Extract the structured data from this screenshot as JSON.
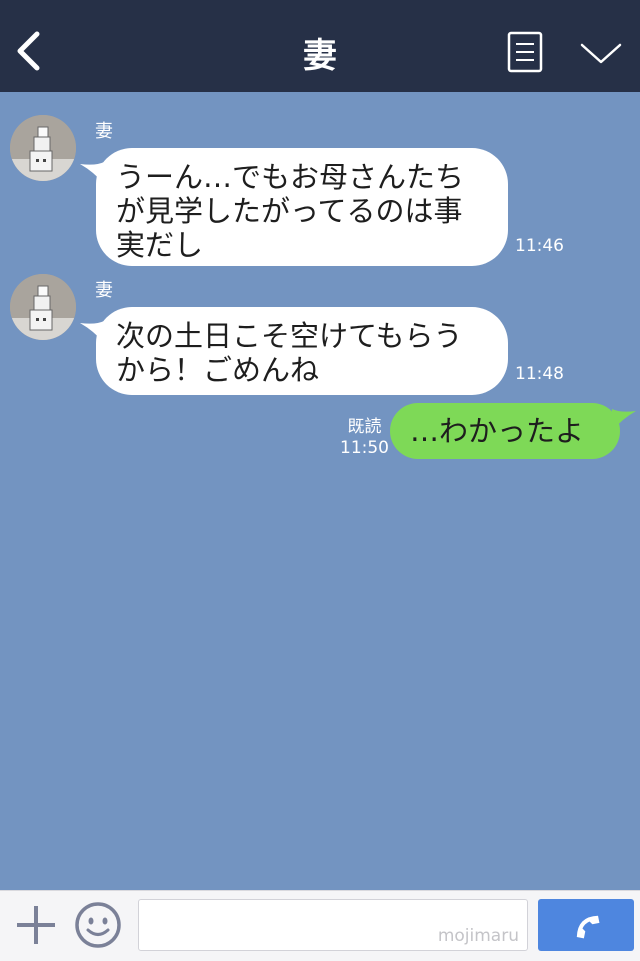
{
  "header": {
    "title": "妻",
    "icons": [
      "chevron-left-icon",
      "menu-list-icon",
      "chevron-down-icon"
    ]
  },
  "messages": [
    {
      "sender": "妻",
      "text_lines": [
        "うーん…でもお母さんたち",
        "が見学したがってるのは事",
        "実だし"
      ],
      "time": "11:46"
    },
    {
      "sender": "妻",
      "text_lines": [
        "次の土日こそ空けてもらう",
        "から！ごめんね"
      ],
      "time": "11:48"
    }
  ],
  "outgoing": {
    "text": "…わかったよ",
    "read_label": "既読",
    "time": "11:50"
  },
  "footer": {
    "watermark": "mojimaru",
    "icons": [
      "plus-icon",
      "emoji-icon",
      "phone-icon"
    ]
  },
  "colors": {
    "header_bg": "#263047",
    "chat_bg": "#7394c1",
    "incoming_bubble": "#ffffff",
    "outgoing_bubble": "#7ed957",
    "call_button": "#4e86df"
  }
}
